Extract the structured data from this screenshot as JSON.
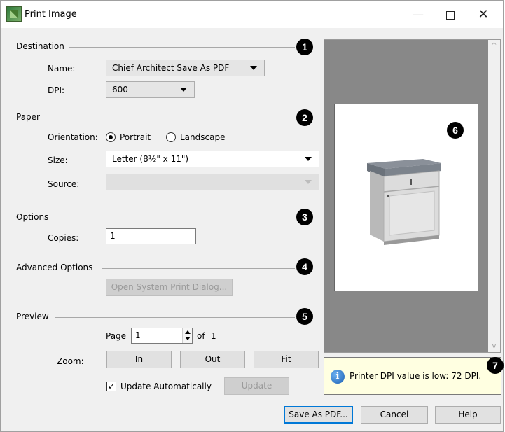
{
  "window": {
    "title": "Print Image",
    "minimize": "—",
    "close": "✕"
  },
  "destination": {
    "group_label": "Destination",
    "badge": "1",
    "name_label": "Name:",
    "name_value": "Chief Architect Save As PDF",
    "dpi_label": "DPI:",
    "dpi_value": "600"
  },
  "paper": {
    "group_label": "Paper",
    "badge": "2",
    "orientation_label": "Orientation:",
    "portrait_label": "Portrait",
    "landscape_label": "Landscape",
    "orientation_selected": "Portrait",
    "size_label": "Size:",
    "size_value": "Letter  (8½\" x 11\")",
    "source_label": "Source:",
    "source_value": ""
  },
  "options": {
    "group_label": "Options",
    "badge": "3",
    "copies_label": "Copies:",
    "copies_value": "1"
  },
  "advanced": {
    "group_label": "Advanced Options",
    "badge": "4",
    "open_dialog_label": "Open System Print Dialog..."
  },
  "preview": {
    "group_label": "Preview",
    "badge": "5",
    "page_label": "Page",
    "page_value": "1",
    "of_label": "of",
    "page_total": "1",
    "zoom_label": "Zoom:",
    "zoom_in": "In",
    "zoom_out": "Out",
    "zoom_fit": "Fit",
    "update_auto_label": "Update Automatically",
    "update_auto_checked": true,
    "update_label": "Update"
  },
  "preview_pane": {
    "badge": "6",
    "scroll_up": "^",
    "scroll_down": "v"
  },
  "info": {
    "badge": "7",
    "icon": "i",
    "message": "Printer DPI value is low: 72 DPI."
  },
  "footer": {
    "save_label": "Save As PDF...",
    "cancel_label": "Cancel",
    "help_label": "Help"
  },
  "colors": {
    "dialog_bg": "#f0f0f0",
    "preview_bg": "#888888",
    "info_bg": "#ffffe1",
    "accent": "#0078d7"
  },
  "icons": {
    "title": "chief-architect-app-icon",
    "info": "info-icon",
    "dropdown": "chevron-down-icon"
  }
}
